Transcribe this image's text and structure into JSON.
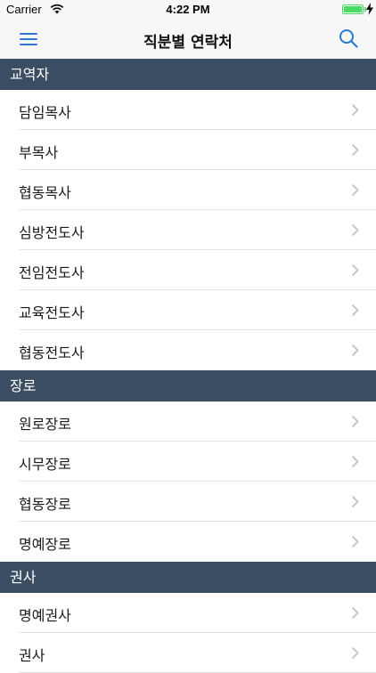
{
  "status_bar": {
    "carrier": "Carrier",
    "time": "4:22 PM",
    "battery_color": "#4cd964"
  },
  "nav": {
    "title": "직분별 연락처",
    "menu_icon": "hamburger-menu-icon",
    "search_icon": "search-icon",
    "accent_color": "#2979d0"
  },
  "colors": {
    "section_header_bg": "#3b4d63",
    "section_header_text": "#ffffff"
  },
  "sections": [
    {
      "title": "교역자",
      "items": [
        "담임목사",
        "부목사",
        "협동목사",
        "심방전도사",
        "전임전도사",
        "교육전도사",
        "협동전도사"
      ]
    },
    {
      "title": "장로",
      "items": [
        "원로장로",
        "시무장로",
        "협동장로",
        "명예장로"
      ]
    },
    {
      "title": "권사",
      "items": [
        "명예권사",
        "권사"
      ]
    }
  ]
}
